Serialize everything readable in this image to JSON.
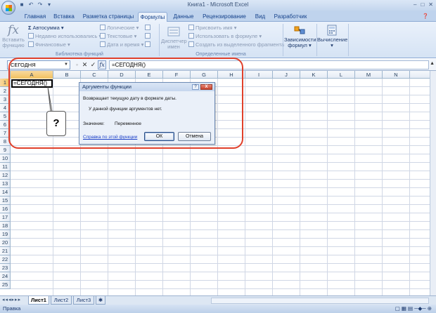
{
  "window": {
    "title": "Книга1 - Microsoft Excel"
  },
  "tabs": [
    "Главная",
    "Вставка",
    "Разметка страницы",
    "Формулы",
    "Данные",
    "Рецензирование",
    "Вид",
    "Разработчик"
  ],
  "active_tab": "Формулы",
  "ribbon": {
    "insert_function": "Вставить функцию",
    "autosum": "Автосумма",
    "recently_used": "Недавно использовались",
    "financial": "Финансовые",
    "logical": "Логические",
    "text": "Текстовые",
    "date_time": "Дата и время",
    "group_library": "Библиотека функций",
    "name_manager": "Диспетчер имен",
    "define_name": "Присвоить имя",
    "use_in_formula": "Использовать в формуле",
    "create_from_selection": "Создать из выделенного фрагмента",
    "group_names": "Определенные имена",
    "dependencies": "Зависимости формул",
    "calculation": "Вычисление"
  },
  "formula_bar": {
    "name_box": "СЕГОДНЯ",
    "formula": "=СЕГОДНЯ()"
  },
  "grid": {
    "columns": [
      "A",
      "B",
      "C",
      "D",
      "E",
      "F",
      "G",
      "H",
      "I",
      "J",
      "K",
      "L",
      "M",
      "N"
    ],
    "rows": [
      "1",
      "2",
      "3",
      "4",
      "5",
      "6",
      "7",
      "8",
      "9",
      "10",
      "11",
      "12",
      "13",
      "14",
      "15",
      "16",
      "17",
      "18",
      "19",
      "20",
      "21",
      "22",
      "23",
      "24",
      "25"
    ],
    "active_cell": "A1",
    "a1_value": "=СЕГОДНЯ()"
  },
  "callout": "?",
  "dialog": {
    "title": "Аргументы функции",
    "help": "?",
    "close": "X",
    "description": "Возвращает текущую дату в формате даты.",
    "no_args": "У данной функции аргументов нет.",
    "value_label": "Значение:",
    "value": "Переменное",
    "help_link": "Справка по этой функции",
    "ok": "ОК",
    "cancel": "Отмена"
  },
  "sheets": [
    "Лист1",
    "Лист2",
    "Лист3"
  ],
  "active_sheet": "Лист1",
  "status": {
    "mode": "Правка"
  }
}
